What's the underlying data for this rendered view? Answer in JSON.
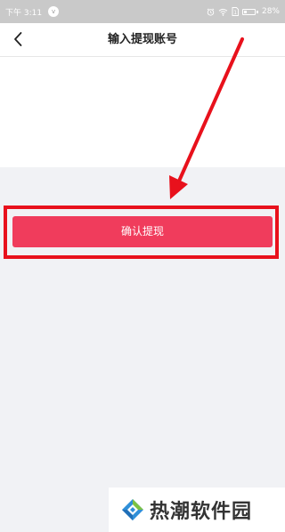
{
  "status_bar": {
    "time": "下午 3:11",
    "notification_glyph": "v",
    "sim_label": "1",
    "battery_percent": "28%",
    "battery_level": 0.28
  },
  "nav": {
    "title": "输入提现账号",
    "back_icon": "chevron-left-icon"
  },
  "action": {
    "confirm_label": "确认提现"
  },
  "annotation": {
    "color": "#e8111c"
  },
  "watermark": {
    "text": "热潮软件园",
    "logo_icon": "diamond-logo-icon"
  },
  "colors": {
    "button": "#f03c5c",
    "page_background": "#f1f2f5",
    "status_bar": "#c9c9c9"
  }
}
